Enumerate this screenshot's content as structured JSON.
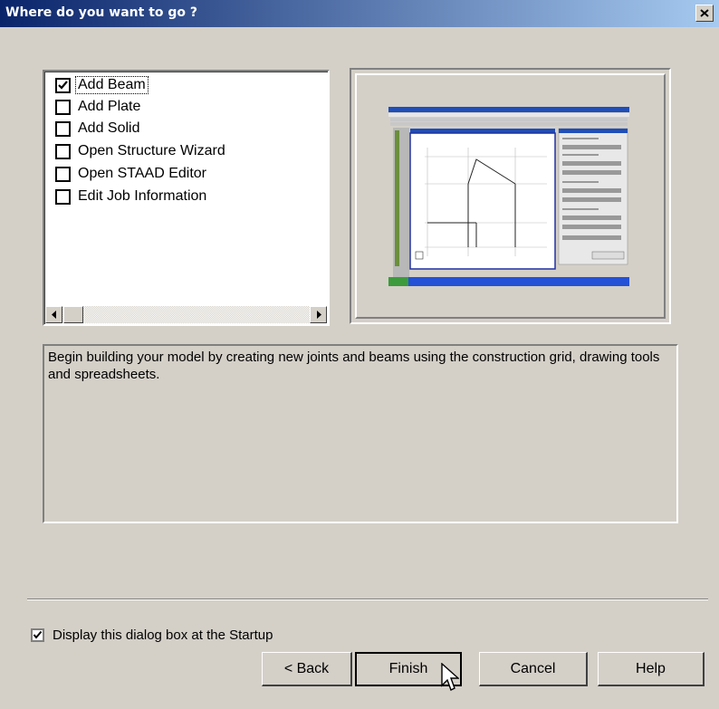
{
  "window": {
    "title": "Where do you want to go ?"
  },
  "options": [
    {
      "label": "Add Beam",
      "checked": true
    },
    {
      "label": "Add Plate",
      "checked": false
    },
    {
      "label": "Add Solid",
      "checked": false
    },
    {
      "label": "Open Structure Wizard",
      "checked": false
    },
    {
      "label": "Open STAAD Editor",
      "checked": false
    },
    {
      "label": "Edit Job Information",
      "checked": false
    }
  ],
  "description": "Begin building your model by creating new joints and beams using the construction grid, drawing tools and spreadsheets.",
  "startup": {
    "label": "Display this dialog box at the Startup",
    "checked": true
  },
  "buttons": {
    "back": "< Back",
    "finish": "Finish",
    "cancel": "Cancel",
    "help": "Help"
  }
}
